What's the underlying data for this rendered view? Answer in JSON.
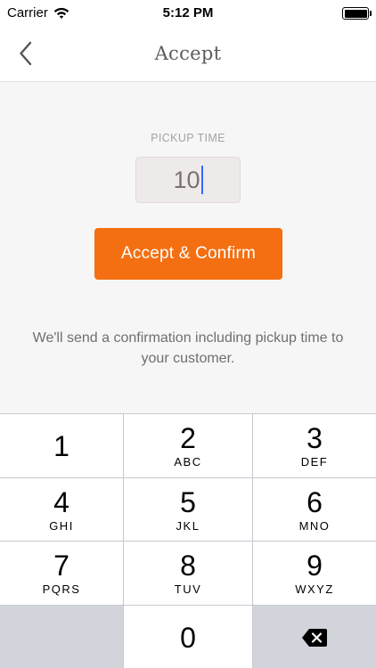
{
  "status_bar": {
    "carrier": "Carrier",
    "time": "5:12 PM"
  },
  "nav": {
    "title": "Accept",
    "back_icon": "chevron-left-icon"
  },
  "form": {
    "pickup_label": "PICKUP TIME",
    "pickup_value": "10",
    "accept_button_label": "Accept & Confirm",
    "info_text": "We'll send a confirmation including pickup time to your customer."
  },
  "keypad": {
    "keys": [
      {
        "digit": "1",
        "letters": ""
      },
      {
        "digit": "2",
        "letters": "ABC"
      },
      {
        "digit": "3",
        "letters": "DEF"
      },
      {
        "digit": "4",
        "letters": "GHI"
      },
      {
        "digit": "5",
        "letters": "JKL"
      },
      {
        "digit": "6",
        "letters": "MNO"
      },
      {
        "digit": "7",
        "letters": "PQRS"
      },
      {
        "digit": "8",
        "letters": "TUV"
      },
      {
        "digit": "9",
        "letters": "WXYZ"
      },
      {
        "digit": "0",
        "letters": ""
      }
    ],
    "delete_icon": "backspace-icon"
  },
  "colors": {
    "accent": "#f36f12",
    "caret": "#2f6bff"
  }
}
